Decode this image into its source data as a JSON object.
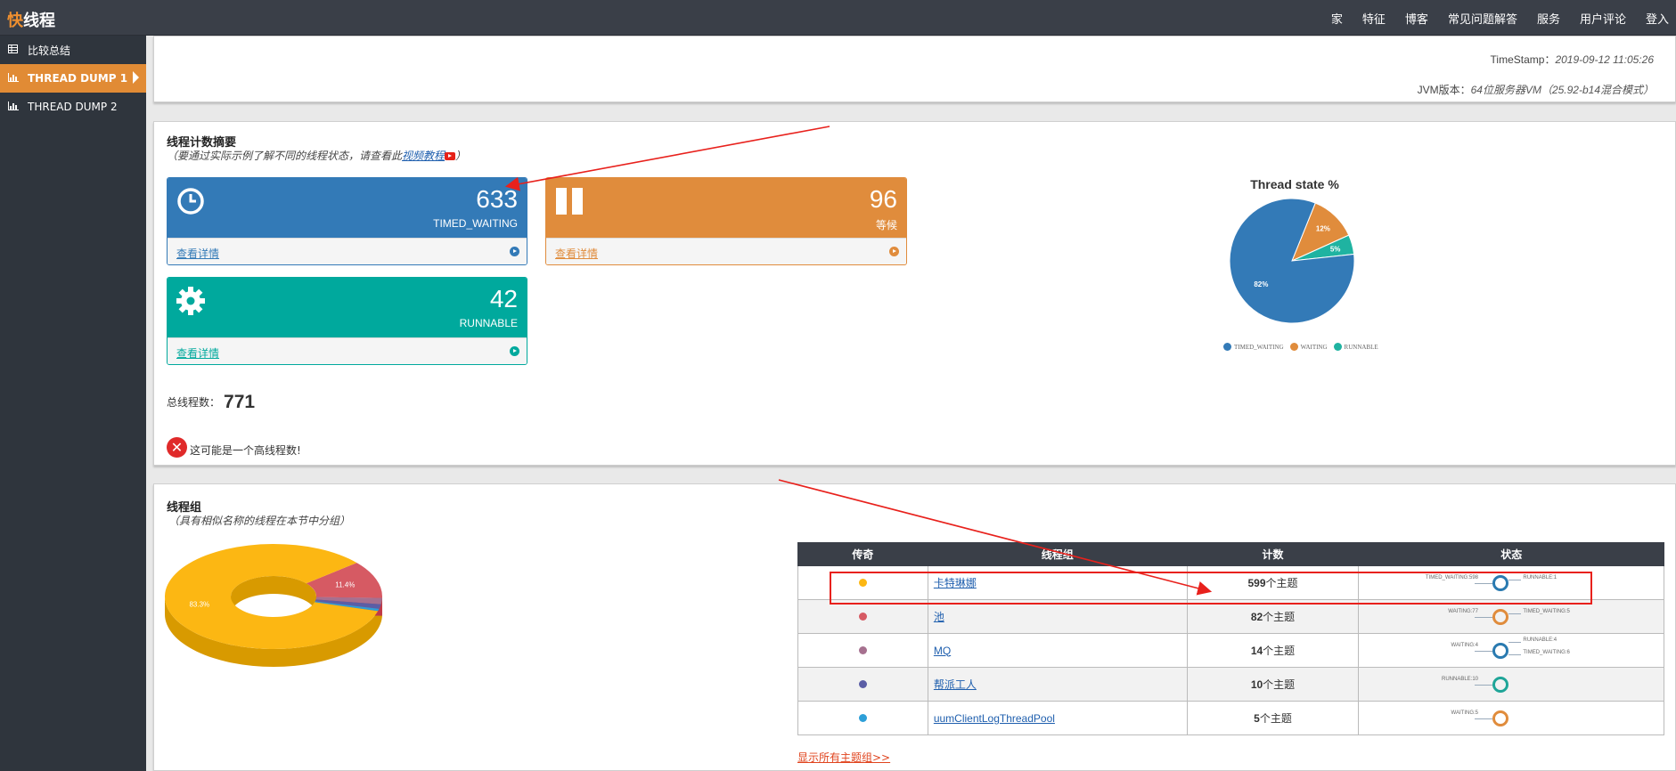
{
  "app": {
    "logo_accent": "快",
    "logo_rest": "线程"
  },
  "nav": [
    "家",
    "特征",
    "博客",
    "常见问题解答",
    "服务",
    "用户评论",
    "登入"
  ],
  "sidebar": {
    "items": [
      {
        "label": "比较总结",
        "icon": "table-icon",
        "active": false
      },
      {
        "label": "THREAD DUMP 1",
        "icon": "bar-chart-icon",
        "active": true
      },
      {
        "label": "THREAD DUMP 2",
        "icon": "bar-chart-icon",
        "active": false
      }
    ]
  },
  "header": {
    "timestamp_label": "TimeStamp：",
    "timestamp_value": "2019-09-12 11:05:26",
    "jvm_label": "JVM版本：",
    "jvm_value": "64位服务器VM（25.92-b14混合模式）"
  },
  "summary": {
    "title": "线程计数摘要",
    "subtitle_pre": "（要通过实际示例了解不同的线程状态，请查看此",
    "subtitle_link": "视频教程",
    "subtitle_post": "）",
    "cards": [
      {
        "count": "633",
        "label": "TIMED_WAITING",
        "link": "查看详情",
        "color": "#337ab7",
        "icon": "clock-icon"
      },
      {
        "count": "96",
        "label": "等候",
        "link": "查看详情",
        "color": "#e08c3c",
        "icon": "pause-icon"
      },
      {
        "count": "42",
        "label": "RUNNABLE",
        "link": "查看详情",
        "color": "#00a99d",
        "icon": "gear-icon"
      }
    ],
    "total_label": "总线程数：",
    "total_value": "771",
    "warning": "这可能是一个高线程数!"
  },
  "chart_data": [
    {
      "type": "pie",
      "title": "Thread state %",
      "categories": [
        "TIMED_WAITING",
        "WAITING",
        "RUNNABLE"
      ],
      "values": [
        82,
        12,
        5
      ],
      "labels": [
        "82%",
        "12%",
        "5%"
      ],
      "colors": [
        "#337ab7",
        "#e08c3c",
        "#1fb3a1"
      ],
      "legend": "bottom"
    },
    {
      "type": "pie",
      "style": "3d-donut",
      "categories": [
        "卡特琳娜",
        "池",
        "MQ",
        "帮派工人",
        "uumClientLogThreadPool"
      ],
      "values": [
        83.3,
        11.4,
        1.9,
        1.4,
        0.7
      ],
      "labels": [
        "83.3%",
        "11.4%",
        "",
        "",
        ""
      ],
      "colors": [
        "#fcb713",
        "#d65a63",
        "#a6708f",
        "#5b5ea6",
        "#2d9fd8"
      ]
    }
  ],
  "groups": {
    "title": "线程组",
    "subtitle": "（具有相似名称的线程在本节中分组）",
    "headers": [
      "传奇",
      "线程组",
      "计数",
      "状态"
    ],
    "rows": [
      {
        "color": "#fcb713",
        "name": "卡特琳娜",
        "count": "599",
        "unit": "个主题",
        "states": [
          "TIMED_WAITING:598",
          "RUNNABLE:1"
        ],
        "ring": "#2a7ab0"
      },
      {
        "color": "#d65a63",
        "name": "池",
        "count": "82",
        "unit": "个主题",
        "states": [
          "WAITING:77",
          "TIMED_WAITING:5"
        ],
        "ring": "#e08c3c"
      },
      {
        "color": "#a6708f",
        "name": "MQ",
        "count": "14",
        "unit": "个主题",
        "states": [
          "WAITING:4",
          "RUNNABLE:4",
          "TIMED_WAITING:6"
        ],
        "ring": "#2a7ab0"
      },
      {
        "color": "#5b5ea6",
        "name": "帮派工人",
        "count": "10",
        "unit": "个主题",
        "states": [
          "RUNNABLE:10"
        ],
        "ring": "#1fa598"
      },
      {
        "color": "#2d9fd8",
        "name": "uumClientLogThreadPool",
        "count": "5",
        "unit": "个主题",
        "states": [
          "WAITING:5"
        ],
        "ring": "#e08c3c"
      }
    ],
    "show_all": "显示所有主题组>>"
  }
}
